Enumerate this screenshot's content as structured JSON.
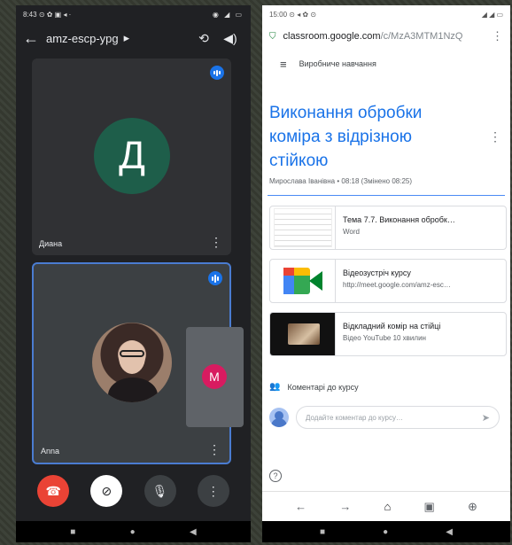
{
  "meet": {
    "status_time": "8:43",
    "status_icons": "⊙ ✿ ▣ ◂ ·",
    "status_right": "◉ ◢ ▭",
    "meeting_code": "amz-escp-ypg",
    "code_caret": "▸",
    "back_icon": "←",
    "switch_camera_icon": "⟲",
    "speaker_icon": "◀)",
    "participants": [
      {
        "name": "Диана",
        "initial": "Д",
        "avatar_color": "#1e5e4a"
      },
      {
        "name": "Anna"
      }
    ],
    "self_initial": "M",
    "self_color": "#d81b60",
    "more_glyph": "⋮",
    "controls": {
      "end": "☎",
      "camera": "⊘",
      "mic": "🎙",
      "more": "⋮"
    },
    "nav": [
      "■",
      "●",
      "◀"
    ]
  },
  "classroom": {
    "status_time": "15:00",
    "status_icons": "⊙ ◂ ✿ ⊙",
    "status_right": "◢ ◢ ▭",
    "url_host": "classroom.google.com",
    "url_path": "/c/MzA3MTM1NzQ",
    "url_more": "⋮",
    "lock_icon": "⛉",
    "menu_icon": "≡",
    "class_name": "Виробниче навчання",
    "title": "Виконання обробки коміра з відрізною стійкою",
    "title_more": "⋮",
    "author": "Мирослава Іванівна • 08:18 (Змінено 08:25)",
    "attachments": [
      {
        "title": "Тема 7.7. Виконання обробк…",
        "subtitle": "Word",
        "kind": "doc"
      },
      {
        "title": "Відеозустріч курсу",
        "subtitle": "http://meet.google.com/amz-esc…",
        "kind": "meet"
      },
      {
        "title": "Відкладний комір на стійці",
        "subtitle": "Відео YouTube   10 хвилин",
        "kind": "video"
      }
    ],
    "comments_label": "Коментарі до курсу",
    "comments_icon": "👥",
    "comment_placeholder": "Додайте коментар до курсу…",
    "send_icon": "➤",
    "help_icon": "?",
    "bottom_nav": [
      "←",
      "→",
      "⌂",
      "▣",
      "⊕"
    ],
    "nav": [
      "■",
      "●",
      "◀"
    ]
  },
  "colors": {
    "meet_bg": "#202124",
    "classroom_accent": "#1a73e8",
    "end_call": "#ea4335",
    "speaking_border": "#4a7cd1"
  }
}
